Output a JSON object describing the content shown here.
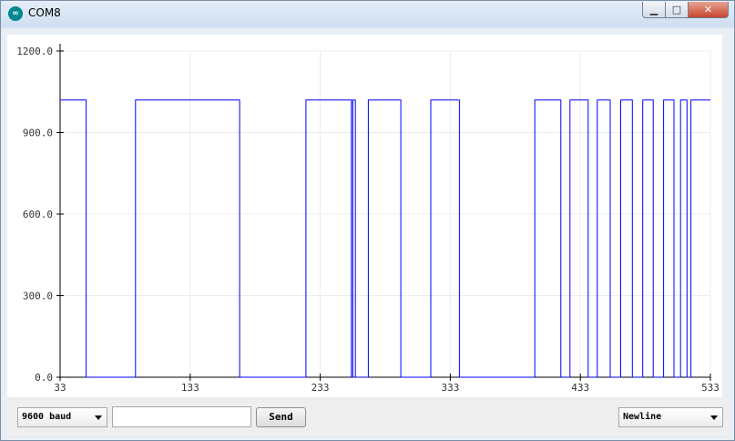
{
  "window": {
    "title": "COM8",
    "icon": "arduino-icon",
    "controls": [
      "minimize-icon",
      "maximize-icon",
      "close-icon"
    ]
  },
  "plotter": {
    "line_color": "#0000ff"
  },
  "chart_data": {
    "type": "line",
    "xlim": [
      33,
      533
    ],
    "ylim": [
      0,
      1200
    ],
    "x_ticks": [
      "33",
      "133",
      "233",
      "333",
      "433",
      "533"
    ],
    "y_ticks": [
      "0.0",
      "300.0",
      "600.0",
      "900.0",
      "1200.0"
    ],
    "grid": true,
    "series": [
      {
        "color": "#0000ff",
        "x": [
          33,
          53,
          53,
          91,
          91,
          171,
          171,
          222,
          222,
          257,
          257,
          258,
          258,
          260,
          260,
          270,
          270,
          295,
          295,
          318,
          318,
          340,
          340,
          398,
          398,
          418,
          418,
          425,
          425,
          439,
          439,
          446,
          446,
          456,
          456,
          464,
          464,
          473,
          473,
          481,
          481,
          489,
          489,
          497,
          497,
          505,
          505,
          510,
          510,
          515,
          515,
          518,
          518,
          522,
          522,
          533
        ],
        "y": [
          1020,
          1020,
          0,
          0,
          1020,
          1020,
          0,
          0,
          1020,
          1020,
          0,
          0,
          1020,
          1020,
          0,
          0,
          1020,
          1020,
          0,
          0,
          1020,
          1020,
          0,
          0,
          1020,
          1020,
          0,
          0,
          1020,
          1020,
          0,
          0,
          1020,
          1020,
          0,
          0,
          1020,
          1020,
          0,
          0,
          1020,
          1020,
          0,
          0,
          1020,
          1020,
          0,
          0,
          1020,
          1020,
          0,
          0,
          1020,
          1020,
          1020,
          1020
        ]
      }
    ]
  },
  "footer": {
    "baud_select": "9600 baud",
    "input_value": "",
    "send_label": "Send",
    "line_ending_select": "Newline"
  }
}
